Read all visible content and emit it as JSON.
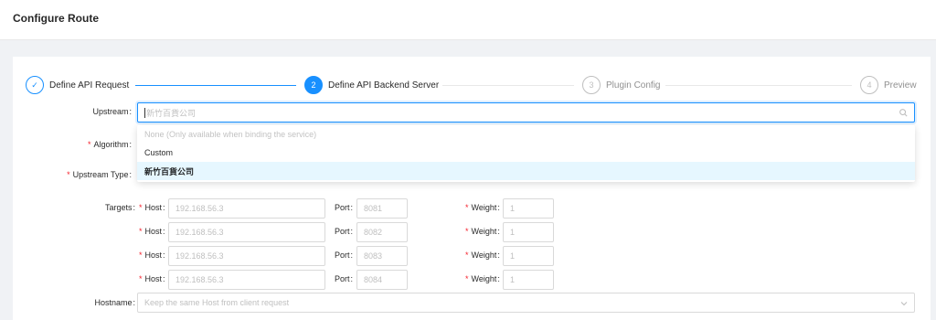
{
  "header": {
    "title": "Configure Route"
  },
  "steps": [
    {
      "num": "✓",
      "title": "Define API Request",
      "status": "finish"
    },
    {
      "num": "2",
      "title": "Define API Backend Server",
      "status": "process"
    },
    {
      "num": "3",
      "title": "Plugin Config",
      "status": "wait"
    },
    {
      "num": "4",
      "title": "Preview",
      "status": "wait"
    }
  ],
  "form": {
    "upstream": {
      "label": "Upstream",
      "value": "新竹百貨公司"
    },
    "algorithm": {
      "label": "Algorithm"
    },
    "upstream_type": {
      "label": "Upstream Type"
    },
    "targets_label": "Targets",
    "host_label": "Host",
    "port_label": "Port",
    "weight_label": "Weight",
    "targets": [
      {
        "host": "192.168.56.3",
        "port": "8081",
        "weight": "1"
      },
      {
        "host": "192.168.56.3",
        "port": "8082",
        "weight": "1"
      },
      {
        "host": "192.168.56.3",
        "port": "8083",
        "weight": "1"
      },
      {
        "host": "192.168.56.3",
        "port": "8084",
        "weight": "1"
      }
    ],
    "hostname": {
      "label": "Hostname",
      "placeholder": "Keep the same Host from client request"
    }
  },
  "dropdown": {
    "options": [
      {
        "label": "None (Only available when binding the service)",
        "state": "disabled"
      },
      {
        "label": "Custom",
        "state": "normal"
      },
      {
        "label": "新竹百貨公司",
        "state": "selected"
      }
    ]
  },
  "colors": {
    "primary": "#1890ff",
    "required": "#f5222d",
    "selected_bg": "#e6f7ff"
  }
}
